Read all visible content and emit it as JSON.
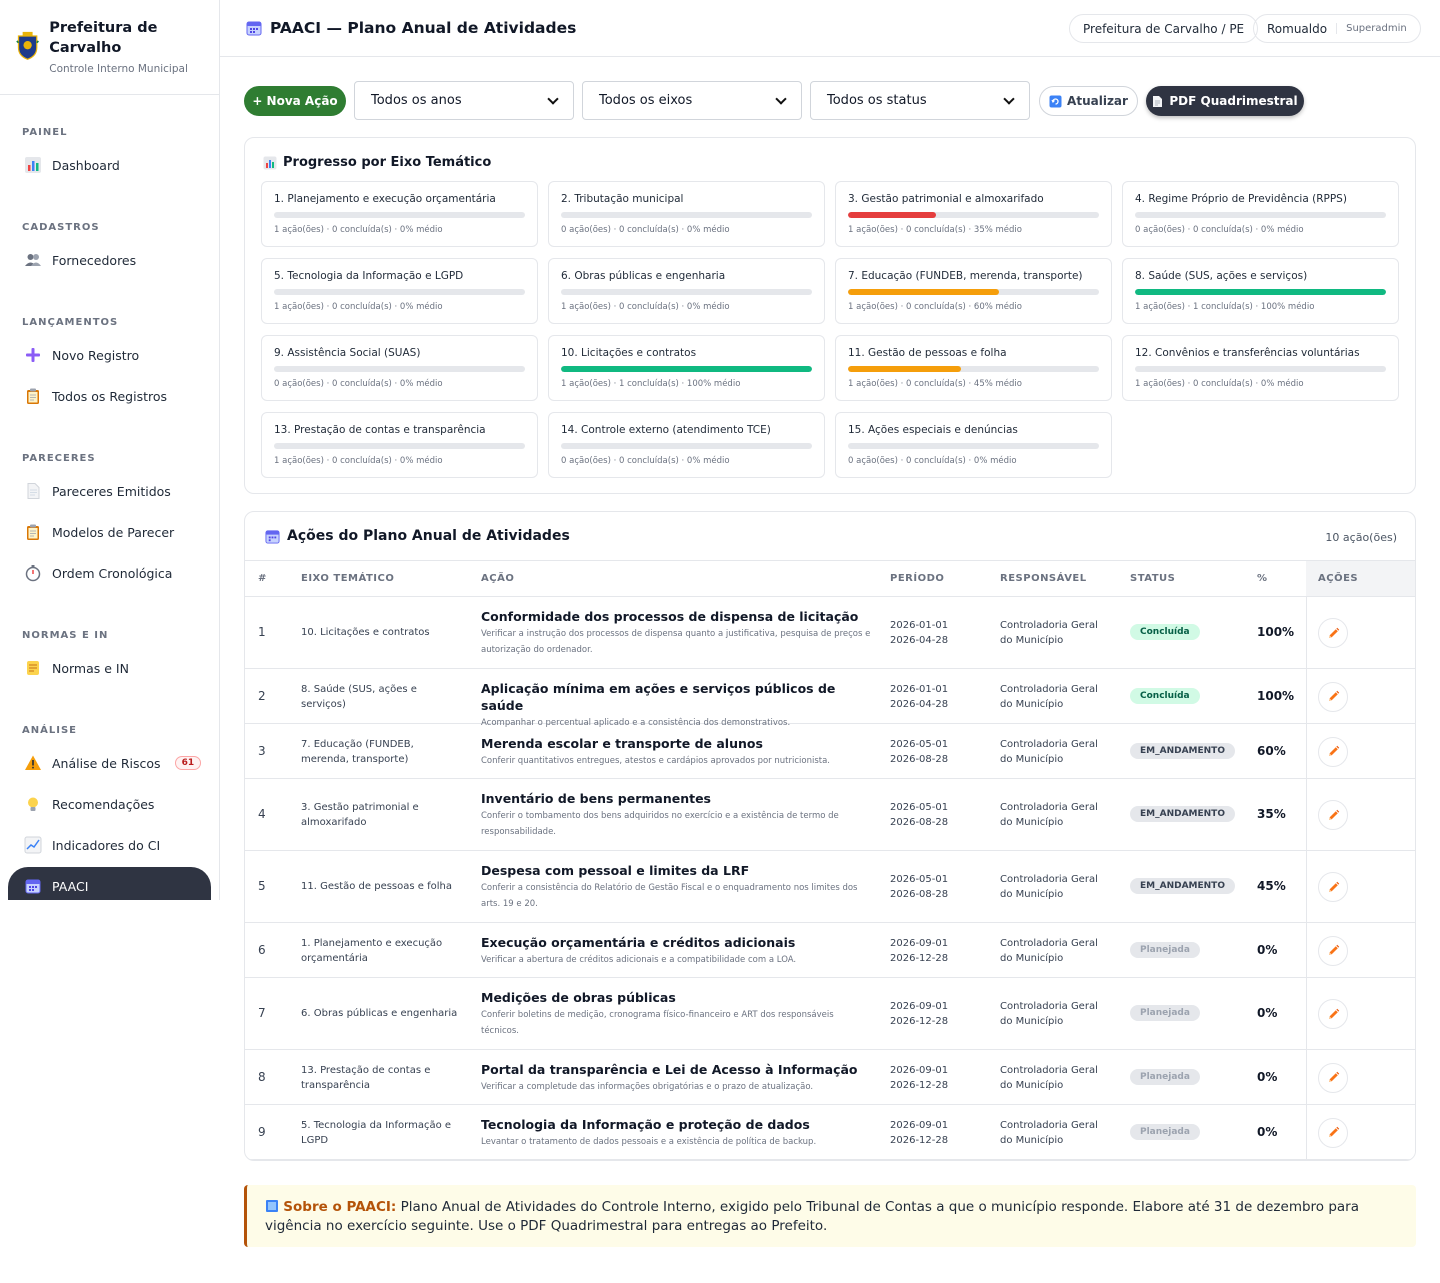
{
  "brand": {
    "title": "Prefeitura de Carvalho",
    "subtitle": "Controle Interno Municipal"
  },
  "sidebar": {
    "sections": [
      {
        "label": "PAINEL"
      },
      {
        "label": "CADASTROS"
      },
      {
        "label": "LANÇAMENTOS"
      },
      {
        "label": "PARECERES"
      },
      {
        "label": "NORMAS E IN"
      },
      {
        "label": "ANÁLISE"
      }
    ],
    "items": [
      {
        "label": "Dashboard",
        "icon": "bar-chart-icon"
      },
      {
        "label": "Fornecedores",
        "icon": "users-icon"
      },
      {
        "label": "Novo Registro",
        "icon": "plus-icon"
      },
      {
        "label": "Todos os Registros",
        "icon": "clipboard-icon"
      },
      {
        "label": "Pareceres Emitidos",
        "icon": "document-icon"
      },
      {
        "label": "Modelos de Parecer",
        "icon": "clipboard-icon"
      },
      {
        "label": "Ordem Cronológica",
        "icon": "stopwatch-icon"
      },
      {
        "label": "Normas e IN",
        "icon": "scroll-icon"
      },
      {
        "label": "Análise de Riscos",
        "icon": "warning-icon",
        "badge": "61"
      },
      {
        "label": "Recomendações",
        "icon": "lightbulb-icon"
      },
      {
        "label": "Indicadores do CI",
        "icon": "line-chart-icon"
      },
      {
        "label": "PAACI",
        "icon": "calendar-icon",
        "active": true
      }
    ]
  },
  "header": {
    "title": "PAACI — Plano Anual de Atividades",
    "org": "Prefeitura de Carvalho / PE",
    "user": "Romualdo",
    "role": "Superadmin"
  },
  "toolbar": {
    "new_action": "+ Nova Ação",
    "year_filter": "Todos os anos",
    "axis_filter": "Todos os eixos",
    "status_filter": "Todos os status",
    "refresh": "Atualizar",
    "pdf": "PDF Quadrimestral"
  },
  "progress": {
    "title": "Progresso por Eixo Temático",
    "axes": [
      {
        "name": "1. Planejamento e execução orçamentária",
        "meta": "1 ação(ões) · 0 concluída(s) · 0% médio",
        "pct": 0,
        "color": "#e5e7eb"
      },
      {
        "name": "2. Tributação municipal",
        "meta": "0 ação(ões) · 0 concluída(s) · 0% médio",
        "pct": 0,
        "color": "#e5e7eb"
      },
      {
        "name": "3. Gestão patrimonial e almoxarifado",
        "meta": "1 ação(ões) · 0 concluída(s) · 35% médio",
        "pct": 35,
        "color": "#e53e3e"
      },
      {
        "name": "4. Regime Próprio de Previdência (RPPS)",
        "meta": "0 ação(ões) · 0 concluída(s) · 0% médio",
        "pct": 0,
        "color": "#e5e7eb"
      },
      {
        "name": "5. Tecnologia da Informação e LGPD",
        "meta": "1 ação(ões) · 0 concluída(s) · 0% médio",
        "pct": 0,
        "color": "#e5e7eb"
      },
      {
        "name": "6. Obras públicas e engenharia",
        "meta": "1 ação(ões) · 0 concluída(s) · 0% médio",
        "pct": 0,
        "color": "#e5e7eb"
      },
      {
        "name": "7. Educação (FUNDEB, merenda, transporte)",
        "meta": "1 ação(ões) · 0 concluída(s) · 60% médio",
        "pct": 60,
        "color": "#f59e0b"
      },
      {
        "name": "8. Saúde (SUS, ações e serviços)",
        "meta": "1 ação(ões) · 1 concluída(s) · 100% médio",
        "pct": 100,
        "color": "#10b981"
      },
      {
        "name": "9. Assistência Social (SUAS)",
        "meta": "0 ação(ões) · 0 concluída(s) · 0% médio",
        "pct": 0,
        "color": "#e5e7eb"
      },
      {
        "name": "10. Licitações e contratos",
        "meta": "1 ação(ões) · 1 concluída(s) · 100% médio",
        "pct": 100,
        "color": "#10b981"
      },
      {
        "name": "11. Gestão de pessoas e folha",
        "meta": "1 ação(ões) · 0 concluída(s) · 45% médio",
        "pct": 45,
        "color": "#f59e0b"
      },
      {
        "name": "12. Convênios e transferências voluntárias",
        "meta": "1 ação(ões) · 0 concluída(s) · 0% médio",
        "pct": 0,
        "color": "#e5e7eb"
      },
      {
        "name": "13. Prestação de contas e transparência",
        "meta": "1 ação(ões) · 0 concluída(s) · 0% médio",
        "pct": 0,
        "color": "#e5e7eb"
      },
      {
        "name": "14. Controle externo (atendimento TCE)",
        "meta": "0 ação(ões) · 0 concluída(s) · 0% médio",
        "pct": 0,
        "color": "#e5e7eb"
      },
      {
        "name": "15. Ações especiais e denúncias",
        "meta": "0 ação(ões) · 0 concluída(s) · 0% médio",
        "pct": 0,
        "color": "#e5e7eb"
      }
    ]
  },
  "table": {
    "title": "Ações do Plano Anual de Atividades",
    "count": "10 ação(ões)",
    "headers": {
      "num": "#",
      "eixo": "EIXO TEMÁTICO",
      "acao": "AÇÃO",
      "periodo": "PERÍODO",
      "responsavel": "RESPONSÁVEL",
      "status": "STATUS",
      "pct": "%",
      "acoes": "AÇÕES"
    },
    "rows": [
      {
        "num": "1",
        "eixo": "10. Licitações e contratos",
        "title": "Conformidade dos processos de dispensa de licitação",
        "desc": "Verificar a instrução dos processos de dispensa quanto a justificativa, pesquisa de preços e autorização do ordenador.",
        "start": "2026-01-01",
        "end": "2026-04-28",
        "resp": "Controladoria Geral do Município",
        "status": "Concluída",
        "status_kind": "done",
        "pct": "100%"
      },
      {
        "num": "2",
        "eixo": "8. Saúde (SUS, ações e serviços)",
        "title": "Aplicação mínima em ações e serviços públicos de saúde",
        "desc": "Acompanhar o percentual aplicado e a consistência dos demonstrativos.",
        "start": "2026-01-01",
        "end": "2026-04-28",
        "resp": "Controladoria Geral do Município",
        "status": "Concluída",
        "status_kind": "done",
        "pct": "100%"
      },
      {
        "num": "3",
        "eixo": "7. Educação (FUNDEB, merenda, transporte)",
        "title": "Merenda escolar e transporte de alunos",
        "desc": "Conferir quantitativos entregues, atestos e cardápios aprovados por nutricionista.",
        "start": "2026-05-01",
        "end": "2026-08-28",
        "resp": "Controladoria Geral do Município",
        "status": "EM_ANDAMENTO",
        "status_kind": "prog",
        "pct": "60%"
      },
      {
        "num": "4",
        "eixo": "3. Gestão patrimonial e almoxarifado",
        "title": "Inventário de bens permanentes",
        "desc": "Conferir o tombamento dos bens adquiridos no exercício e a existência de termo de responsabilidade.",
        "start": "2026-05-01",
        "end": "2026-08-28",
        "resp": "Controladoria Geral do Município",
        "status": "EM_ANDAMENTO",
        "status_kind": "prog",
        "pct": "35%"
      },
      {
        "num": "5",
        "eixo": "11. Gestão de pessoas e folha",
        "title": "Despesa com pessoal e limites da LRF",
        "desc": "Conferir a consistência do Relatório de Gestão Fiscal e o enquadramento nos limites dos arts. 19 e 20.",
        "start": "2026-05-01",
        "end": "2026-08-28",
        "resp": "Controladoria Geral do Município",
        "status": "EM_ANDAMENTO",
        "status_kind": "prog",
        "pct": "45%"
      },
      {
        "num": "6",
        "eixo": "1. Planejamento e execução orçamentária",
        "title": "Execução orçamentária e créditos adicionais",
        "desc": "Verificar a abertura de créditos adicionais e a compatibilidade com a LOA.",
        "start": "2026-09-01",
        "end": "2026-12-28",
        "resp": "Controladoria Geral do Município",
        "status": "Planejada",
        "status_kind": "plan",
        "pct": "0%"
      },
      {
        "num": "7",
        "eixo": "6. Obras públicas e engenharia",
        "title": "Medições de obras públicas",
        "desc": "Conferir boletins de medição, cronograma físico-financeiro e ART dos responsáveis técnicos.",
        "start": "2026-09-01",
        "end": "2026-12-28",
        "resp": "Controladoria Geral do Município",
        "status": "Planejada",
        "status_kind": "plan",
        "pct": "0%"
      },
      {
        "num": "8",
        "eixo": "13. Prestação de contas e transparência",
        "title": "Portal da transparência e Lei de Acesso à Informação",
        "desc": "Verificar a completude das informações obrigatórias e o prazo de atualização.",
        "start": "2026-09-01",
        "end": "2026-12-28",
        "resp": "Controladoria Geral do Município",
        "status": "Planejada",
        "status_kind": "plan",
        "pct": "0%"
      },
      {
        "num": "9",
        "eixo": "5. Tecnologia da Informação e LGPD",
        "title": "Tecnologia da Informação e proteção de dados",
        "desc": "Levantar o tratamento de dados pessoais e a existência de política de backup.",
        "start": "2026-09-01",
        "end": "2026-12-28",
        "resp": "Controladoria Geral do Município",
        "status": "Planejada",
        "status_kind": "plan",
        "pct": "0%"
      }
    ]
  },
  "info": {
    "label": "Sobre o PAACI:",
    "text": " Plano Anual de Atividades do Controle Interno, exigido pelo Tribunal de Contas a que o município responde. Elabore até 31 de dezembro para vigência no exercício seguinte. Use o PDF Quadrimestral para entregas ao Prefeito."
  }
}
